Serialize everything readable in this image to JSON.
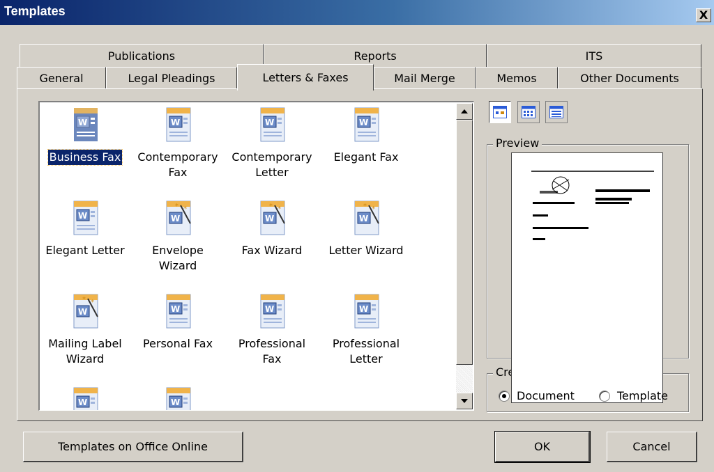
{
  "window": {
    "title": "Templates",
    "close_label": "X"
  },
  "tabs_top": [
    {
      "label": "Publications"
    },
    {
      "label": "Reports"
    },
    {
      "label": "ITS"
    }
  ],
  "tabs_bottom": [
    {
      "label": "General"
    },
    {
      "label": "Legal Pleadings"
    },
    {
      "label": "Letters & Faxes",
      "active": true
    },
    {
      "label": "Mail Merge"
    },
    {
      "label": "Memos"
    },
    {
      "label": "Other Documents"
    }
  ],
  "templates": [
    {
      "label": "Business Fax",
      "icon": "word-doc-icon",
      "selected": true
    },
    {
      "label": "Contemporary Fax",
      "icon": "word-doc-icon"
    },
    {
      "label": "Contemporary Letter",
      "icon": "word-doc-icon"
    },
    {
      "label": "Elegant Fax",
      "icon": "word-doc-icon"
    },
    {
      "label": "Elegant Letter",
      "icon": "word-doc-icon"
    },
    {
      "label": "Envelope Wizard",
      "icon": "word-wizard-icon"
    },
    {
      "label": "Fax Wizard",
      "icon": "word-wizard-icon"
    },
    {
      "label": "Letter Wizard",
      "icon": "word-wizard-icon"
    },
    {
      "label": "Mailing Label Wizard",
      "icon": "word-wizard-icon"
    },
    {
      "label": "Personal Fax",
      "icon": "word-doc-icon"
    },
    {
      "label": "Professional Fax",
      "icon": "word-doc-icon"
    },
    {
      "label": "Professional Letter",
      "icon": "word-doc-icon"
    },
    {
      "label": "",
      "icon": "word-doc-icon"
    },
    {
      "label": "",
      "icon": "word-doc-icon"
    }
  ],
  "view_buttons": [
    {
      "icon": "large-icons-view-icon",
      "pressed": true
    },
    {
      "icon": "list-view-icon",
      "pressed": false
    },
    {
      "icon": "details-view-icon",
      "pressed": false
    }
  ],
  "preview": {
    "title": "Preview"
  },
  "create_new": {
    "title": "Create New",
    "options": [
      {
        "label": "Document",
        "checked": true
      },
      {
        "label": "Template",
        "checked": false
      }
    ]
  },
  "buttons": {
    "online": "Templates on Office Online",
    "ok": "OK",
    "cancel": "Cancel"
  },
  "colors": {
    "title_start": "#0a246a",
    "title_end": "#a6caf0",
    "face": "#d4d0c8",
    "selection": "#0a246a"
  }
}
